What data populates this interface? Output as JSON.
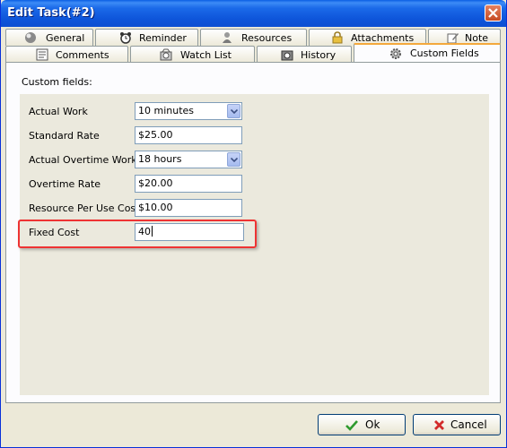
{
  "window": {
    "title": "Edit Task(#2)"
  },
  "tabs_row1": [
    {
      "label": "General",
      "icon": "general-sphere-icon"
    },
    {
      "label": "Reminder",
      "icon": "alarm-clock-icon"
    },
    {
      "label": "Resources",
      "icon": "person-icon"
    },
    {
      "label": "Attachments",
      "icon": "padlock-icon"
    },
    {
      "label": "Note",
      "icon": "note-pencil-icon"
    }
  ],
  "tabs_row2": [
    {
      "label": "Comments",
      "icon": "comments-icon"
    },
    {
      "label": "Watch List",
      "icon": "watch-list-icon"
    },
    {
      "label": "History",
      "icon": "history-icon"
    },
    {
      "label": "Custom Fields",
      "icon": "gear-icon",
      "active": true
    }
  ],
  "panel": {
    "heading": "Custom fields:",
    "fields": [
      {
        "label": "Actual Work",
        "value": "10 minutes",
        "type": "select"
      },
      {
        "label": "Standard Rate",
        "value": "$25.00",
        "type": "text"
      },
      {
        "label": "Actual Overtime Work",
        "value": "18 hours",
        "type": "select"
      },
      {
        "label": "Overtime Rate",
        "value": "$20.00",
        "type": "text"
      },
      {
        "label": "Resource Per Use Cost",
        "value": "$10.00",
        "type": "text"
      },
      {
        "label": "Fixed Cost",
        "value": "40",
        "type": "text",
        "focused": true,
        "highlighted": true
      }
    ]
  },
  "buttons": {
    "ok": "Ok",
    "cancel": "Cancel"
  },
  "colors": {
    "title_bar": "#0d55da",
    "highlight_border": "#e33333",
    "active_tab_accent": "#f3a83c",
    "ok_check": "#2e9a2e",
    "cancel_x": "#d22b2b"
  }
}
